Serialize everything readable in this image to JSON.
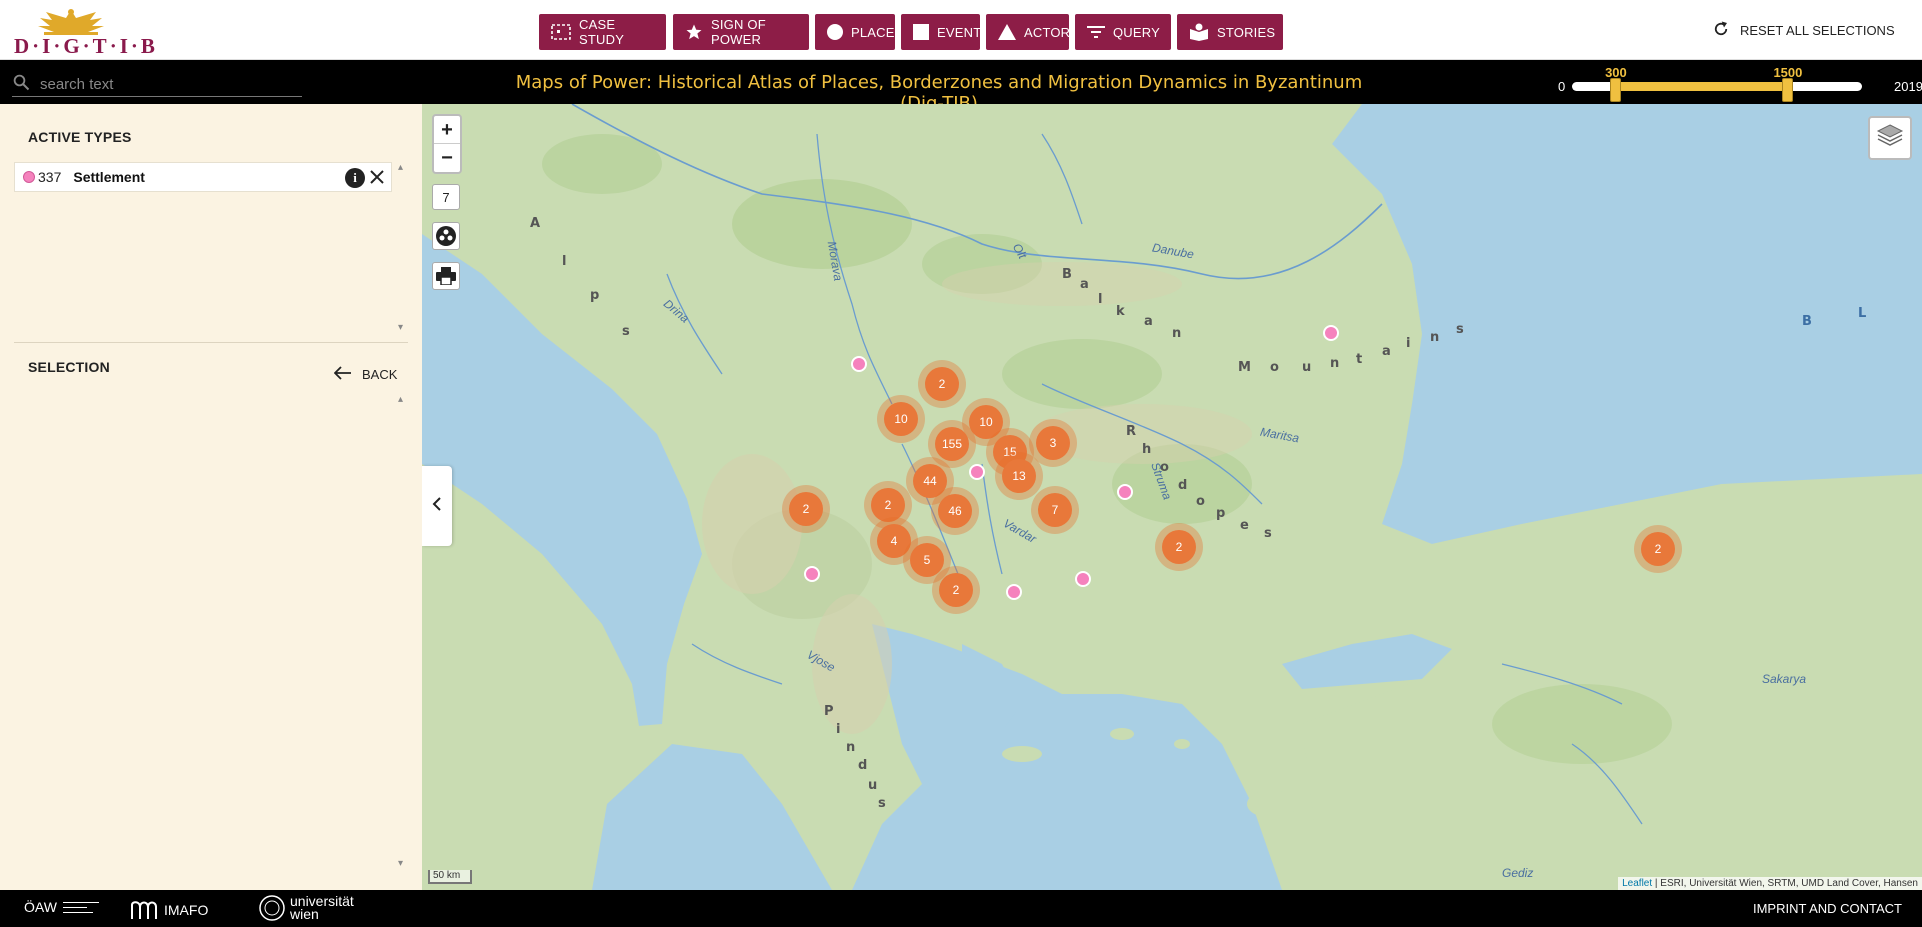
{
  "logo": {
    "wordmark": "D·I·G·T·I·B"
  },
  "nav": [
    {
      "label": "CASE STUDY",
      "icon": "case-study-icon"
    },
    {
      "label": "SIGN OF POWER",
      "icon": "star-icon"
    },
    {
      "label": "PLACE",
      "icon": "circle-icon"
    },
    {
      "label": "EVENT",
      "icon": "square-icon"
    },
    {
      "label": "ACTOR",
      "icon": "triangle-icon"
    },
    {
      "label": "QUERY",
      "icon": "filter-icon"
    },
    {
      "label": "STORIES",
      "icon": "stories-icon"
    }
  ],
  "reset_label": "RESET ALL SELECTIONS",
  "search": {
    "placeholder": "search text"
  },
  "title": "Maps of Power: Historical Atlas of Places, Borderzones and Migration Dynamics in Byzantinum (Dig-TIB)",
  "time_slider": {
    "min": "0",
    "max": "2019",
    "from": "300",
    "to": "1500",
    "from_value": 300,
    "to_value": 1500,
    "range_min": 0,
    "range_max": 2019
  },
  "sidebar": {
    "active_types_heading": "ACTIVE TYPES",
    "types": [
      {
        "count": "337",
        "name": "Settlement",
        "color": "#f582bd"
      }
    ],
    "selection_heading": "SELECTION",
    "back_label": "BACK"
  },
  "map": {
    "zoom_level": "7",
    "zoom_in": "+",
    "zoom_out": "−",
    "scale_label": "50 km",
    "attribution_link": "Leaflet",
    "attribution_text": " | ESRI, Universität Wien, SRTM, UMD Land Cover, Hansen",
    "clusters": [
      "2",
      "10",
      "10",
      "155",
      "15",
      "3",
      "44",
      "13",
      "2",
      "2",
      "46",
      "7",
      "4",
      "5",
      "2",
      "2",
      "2"
    ],
    "labels": {
      "danube": "Danube",
      "drina": "Drina",
      "morava": "Morava",
      "olt": "Olt",
      "maritsa": "Maritsa",
      "struma": "Struma",
      "vardar": "Vardar",
      "vjose": "Vjose",
      "sakarya": "Sakarya",
      "gediz": "Gediz"
    },
    "mountain_letters": {
      "alps": [
        "A",
        "l",
        "p",
        "s"
      ],
      "balkan": [
        "B",
        "a",
        "l",
        "k",
        "a",
        "n",
        "M",
        "o",
        "u",
        "n",
        "t",
        "a",
        "i",
        "n",
        "s"
      ],
      "rhodopes": [
        "R",
        "h",
        "o",
        "d",
        "o",
        "p",
        "e",
        "s"
      ],
      "pindus": [
        "P",
        "i",
        "n",
        "d",
        "u",
        "s"
      ],
      "sea": [
        "B",
        "L"
      ]
    }
  },
  "footer": {
    "oaw": "ÖAW",
    "imafo": "IMAFO",
    "uni_line1": "universität",
    "uni_line2": "wien",
    "imprint": "IMPRINT AND CONTACT"
  },
  "colors": {
    "brand": "#8d1d47",
    "title": "#f0c040",
    "cluster": "#e8783a",
    "settlement": "#f582bd",
    "sea": "#a9cfe4",
    "land": "#c9dcb2"
  }
}
